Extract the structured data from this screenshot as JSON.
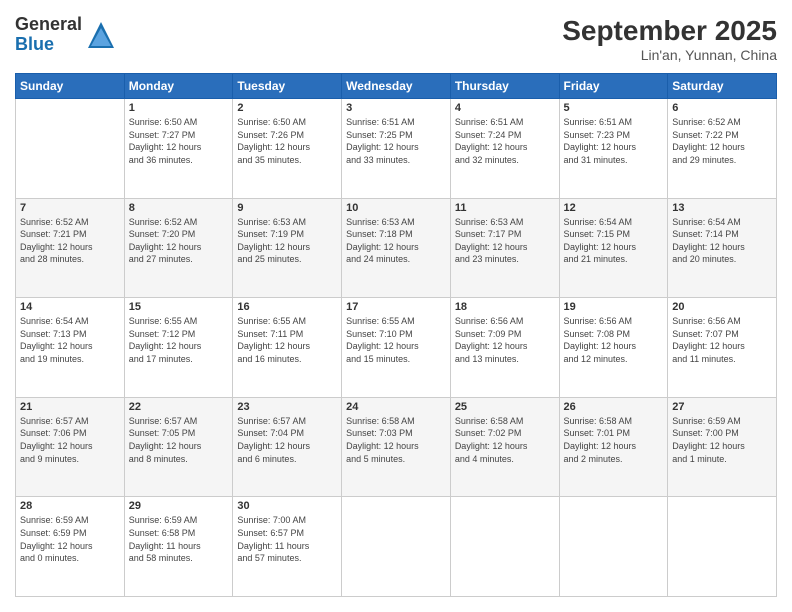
{
  "logo": {
    "general": "General",
    "blue": "Blue"
  },
  "header": {
    "month": "September 2025",
    "location": "Lin'an, Yunnan, China"
  },
  "days_of_week": [
    "Sunday",
    "Monday",
    "Tuesday",
    "Wednesday",
    "Thursday",
    "Friday",
    "Saturday"
  ],
  "weeks": [
    [
      {
        "day": "",
        "info": ""
      },
      {
        "day": "1",
        "info": "Sunrise: 6:50 AM\nSunset: 7:27 PM\nDaylight: 12 hours\nand 36 minutes."
      },
      {
        "day": "2",
        "info": "Sunrise: 6:50 AM\nSunset: 7:26 PM\nDaylight: 12 hours\nand 35 minutes."
      },
      {
        "day": "3",
        "info": "Sunrise: 6:51 AM\nSunset: 7:25 PM\nDaylight: 12 hours\nand 33 minutes."
      },
      {
        "day": "4",
        "info": "Sunrise: 6:51 AM\nSunset: 7:24 PM\nDaylight: 12 hours\nand 32 minutes."
      },
      {
        "day": "5",
        "info": "Sunrise: 6:51 AM\nSunset: 7:23 PM\nDaylight: 12 hours\nand 31 minutes."
      },
      {
        "day": "6",
        "info": "Sunrise: 6:52 AM\nSunset: 7:22 PM\nDaylight: 12 hours\nand 29 minutes."
      }
    ],
    [
      {
        "day": "7",
        "info": "Sunrise: 6:52 AM\nSunset: 7:21 PM\nDaylight: 12 hours\nand 28 minutes."
      },
      {
        "day": "8",
        "info": "Sunrise: 6:52 AM\nSunset: 7:20 PM\nDaylight: 12 hours\nand 27 minutes."
      },
      {
        "day": "9",
        "info": "Sunrise: 6:53 AM\nSunset: 7:19 PM\nDaylight: 12 hours\nand 25 minutes."
      },
      {
        "day": "10",
        "info": "Sunrise: 6:53 AM\nSunset: 7:18 PM\nDaylight: 12 hours\nand 24 minutes."
      },
      {
        "day": "11",
        "info": "Sunrise: 6:53 AM\nSunset: 7:17 PM\nDaylight: 12 hours\nand 23 minutes."
      },
      {
        "day": "12",
        "info": "Sunrise: 6:54 AM\nSunset: 7:15 PM\nDaylight: 12 hours\nand 21 minutes."
      },
      {
        "day": "13",
        "info": "Sunrise: 6:54 AM\nSunset: 7:14 PM\nDaylight: 12 hours\nand 20 minutes."
      }
    ],
    [
      {
        "day": "14",
        "info": "Sunrise: 6:54 AM\nSunset: 7:13 PM\nDaylight: 12 hours\nand 19 minutes."
      },
      {
        "day": "15",
        "info": "Sunrise: 6:55 AM\nSunset: 7:12 PM\nDaylight: 12 hours\nand 17 minutes."
      },
      {
        "day": "16",
        "info": "Sunrise: 6:55 AM\nSunset: 7:11 PM\nDaylight: 12 hours\nand 16 minutes."
      },
      {
        "day": "17",
        "info": "Sunrise: 6:55 AM\nSunset: 7:10 PM\nDaylight: 12 hours\nand 15 minutes."
      },
      {
        "day": "18",
        "info": "Sunrise: 6:56 AM\nSunset: 7:09 PM\nDaylight: 12 hours\nand 13 minutes."
      },
      {
        "day": "19",
        "info": "Sunrise: 6:56 AM\nSunset: 7:08 PM\nDaylight: 12 hours\nand 12 minutes."
      },
      {
        "day": "20",
        "info": "Sunrise: 6:56 AM\nSunset: 7:07 PM\nDaylight: 12 hours\nand 11 minutes."
      }
    ],
    [
      {
        "day": "21",
        "info": "Sunrise: 6:57 AM\nSunset: 7:06 PM\nDaylight: 12 hours\nand 9 minutes."
      },
      {
        "day": "22",
        "info": "Sunrise: 6:57 AM\nSunset: 7:05 PM\nDaylight: 12 hours\nand 8 minutes."
      },
      {
        "day": "23",
        "info": "Sunrise: 6:57 AM\nSunset: 7:04 PM\nDaylight: 12 hours\nand 6 minutes."
      },
      {
        "day": "24",
        "info": "Sunrise: 6:58 AM\nSunset: 7:03 PM\nDaylight: 12 hours\nand 5 minutes."
      },
      {
        "day": "25",
        "info": "Sunrise: 6:58 AM\nSunset: 7:02 PM\nDaylight: 12 hours\nand 4 minutes."
      },
      {
        "day": "26",
        "info": "Sunrise: 6:58 AM\nSunset: 7:01 PM\nDaylight: 12 hours\nand 2 minutes."
      },
      {
        "day": "27",
        "info": "Sunrise: 6:59 AM\nSunset: 7:00 PM\nDaylight: 12 hours\nand 1 minute."
      }
    ],
    [
      {
        "day": "28",
        "info": "Sunrise: 6:59 AM\nSunset: 6:59 PM\nDaylight: 12 hours\nand 0 minutes."
      },
      {
        "day": "29",
        "info": "Sunrise: 6:59 AM\nSunset: 6:58 PM\nDaylight: 11 hours\nand 58 minutes."
      },
      {
        "day": "30",
        "info": "Sunrise: 7:00 AM\nSunset: 6:57 PM\nDaylight: 11 hours\nand 57 minutes."
      },
      {
        "day": "",
        "info": ""
      },
      {
        "day": "",
        "info": ""
      },
      {
        "day": "",
        "info": ""
      },
      {
        "day": "",
        "info": ""
      }
    ]
  ]
}
